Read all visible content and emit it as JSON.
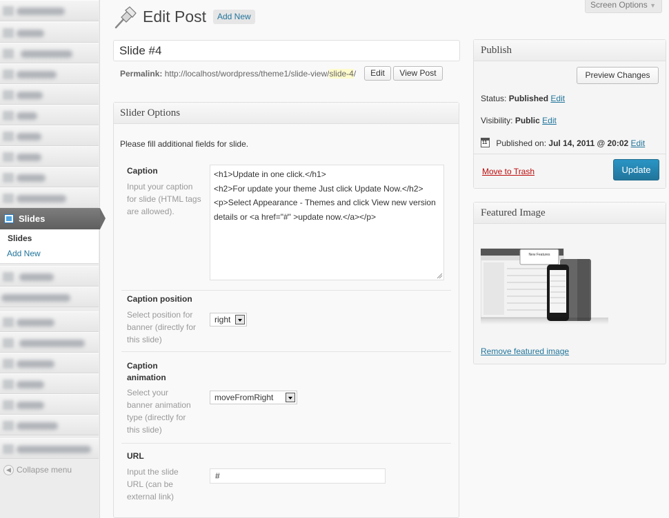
{
  "sidebar": {
    "current_menu": "Slides",
    "submenu": [
      "Slides",
      "Add New"
    ],
    "collapse_label": "Collapse menu"
  },
  "header": {
    "title": "Edit Post",
    "add_new": "Add New",
    "screen_options": "Screen Options"
  },
  "post": {
    "title": "Slide #4",
    "permalink_label": "Permalink:",
    "permalink_base": "http://localhost/wordpress/theme1/slide-view/",
    "permalink_slug": "slide-4",
    "permalink_end": "/",
    "edit_button": "Edit",
    "view_button": "View Post"
  },
  "slider_options": {
    "heading": "Slider Options",
    "intro": "Please fill additional fields for slide.",
    "caption": {
      "label": "Caption",
      "description": "Input your caption for slide (HTML tags are allowed).",
      "value": "<h1>Update in one click.</h1>\n<h2>For update your theme Just click Update Now.</h2>\n<p>Select Appearance - Themes and click View new version details or <a href=\"#\" >update now.</a></p>"
    },
    "caption_position": {
      "label": "Caption position",
      "description": "Select position for banner (directly for this slide)",
      "value": "right"
    },
    "caption_animation": {
      "label": "Caption animation",
      "description": "Select your banner animation type (directly for this slide)",
      "value": "moveFromRight"
    },
    "url": {
      "label": "URL",
      "description": "Input the slide URL (can be external link)",
      "value": "#"
    }
  },
  "publish": {
    "heading": "Publish",
    "preview_button": "Preview Changes",
    "status_label": "Status:",
    "status_value": "Published",
    "visibility_label": "Visibility:",
    "visibility_value": "Public",
    "published_label": "Published on:",
    "published_value": "Jul 14, 2011 @ 20:02",
    "edit_link": "Edit",
    "trash_link": "Move to Trash",
    "update_button": "Update"
  },
  "featured_image": {
    "heading": "Featured Image",
    "remove_link": "Remove featured image",
    "thumb_caption": "New Features"
  },
  "colors": {
    "link": "#21759b",
    "primary_button": "#21759b",
    "trash": "#bc0b0b"
  }
}
